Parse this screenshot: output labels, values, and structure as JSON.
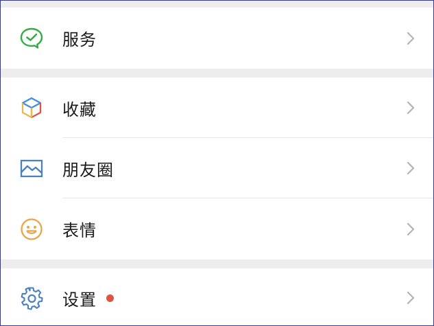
{
  "menu": {
    "service": {
      "label": "服务",
      "icon": "wechat-pay-icon"
    },
    "favorites": {
      "label": "收藏",
      "icon": "cube-icon"
    },
    "moments": {
      "label": "朋友圈",
      "icon": "picture-icon"
    },
    "stickers": {
      "label": "表情",
      "icon": "smiley-icon"
    },
    "settings": {
      "label": "设置",
      "icon": "gear-icon",
      "has_red_dot": true
    }
  },
  "colors": {
    "service_green": "#2fae45",
    "picture_blue": "#4a7fc0",
    "smiley_orange": "#e8a54a",
    "gear_blue": "#4a7fc0",
    "badge_red": "#e0533f",
    "chevron_gray": "#b3b3b3",
    "separator_gray": "#ededed"
  }
}
